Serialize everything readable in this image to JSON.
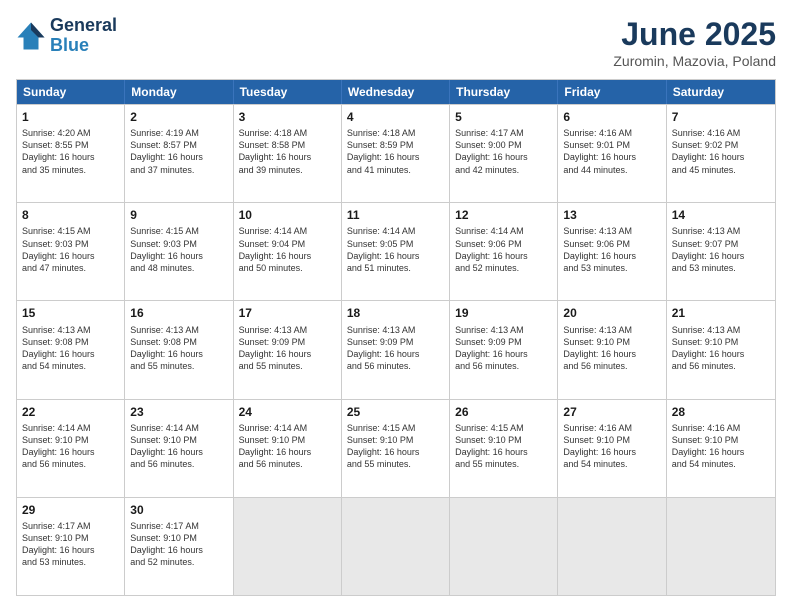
{
  "header": {
    "logo_line1": "General",
    "logo_line2": "Blue",
    "month": "June 2025",
    "location": "Zuromin, Mazovia, Poland"
  },
  "days_of_week": [
    "Sunday",
    "Monday",
    "Tuesday",
    "Wednesday",
    "Thursday",
    "Friday",
    "Saturday"
  ],
  "weeks": [
    [
      {
        "day": "1",
        "lines": [
          "Sunrise: 4:20 AM",
          "Sunset: 8:55 PM",
          "Daylight: 16 hours",
          "and 35 minutes."
        ]
      },
      {
        "day": "2",
        "lines": [
          "Sunrise: 4:19 AM",
          "Sunset: 8:57 PM",
          "Daylight: 16 hours",
          "and 37 minutes."
        ]
      },
      {
        "day": "3",
        "lines": [
          "Sunrise: 4:18 AM",
          "Sunset: 8:58 PM",
          "Daylight: 16 hours",
          "and 39 minutes."
        ]
      },
      {
        "day": "4",
        "lines": [
          "Sunrise: 4:18 AM",
          "Sunset: 8:59 PM",
          "Daylight: 16 hours",
          "and 41 minutes."
        ]
      },
      {
        "day": "5",
        "lines": [
          "Sunrise: 4:17 AM",
          "Sunset: 9:00 PM",
          "Daylight: 16 hours",
          "and 42 minutes."
        ]
      },
      {
        "day": "6",
        "lines": [
          "Sunrise: 4:16 AM",
          "Sunset: 9:01 PM",
          "Daylight: 16 hours",
          "and 44 minutes."
        ]
      },
      {
        "day": "7",
        "lines": [
          "Sunrise: 4:16 AM",
          "Sunset: 9:02 PM",
          "Daylight: 16 hours",
          "and 45 minutes."
        ]
      }
    ],
    [
      {
        "day": "8",
        "lines": [
          "Sunrise: 4:15 AM",
          "Sunset: 9:03 PM",
          "Daylight: 16 hours",
          "and 47 minutes."
        ]
      },
      {
        "day": "9",
        "lines": [
          "Sunrise: 4:15 AM",
          "Sunset: 9:03 PM",
          "Daylight: 16 hours",
          "and 48 minutes."
        ]
      },
      {
        "day": "10",
        "lines": [
          "Sunrise: 4:14 AM",
          "Sunset: 9:04 PM",
          "Daylight: 16 hours",
          "and 50 minutes."
        ]
      },
      {
        "day": "11",
        "lines": [
          "Sunrise: 4:14 AM",
          "Sunset: 9:05 PM",
          "Daylight: 16 hours",
          "and 51 minutes."
        ]
      },
      {
        "day": "12",
        "lines": [
          "Sunrise: 4:14 AM",
          "Sunset: 9:06 PM",
          "Daylight: 16 hours",
          "and 52 minutes."
        ]
      },
      {
        "day": "13",
        "lines": [
          "Sunrise: 4:13 AM",
          "Sunset: 9:06 PM",
          "Daylight: 16 hours",
          "and 53 minutes."
        ]
      },
      {
        "day": "14",
        "lines": [
          "Sunrise: 4:13 AM",
          "Sunset: 9:07 PM",
          "Daylight: 16 hours",
          "and 53 minutes."
        ]
      }
    ],
    [
      {
        "day": "15",
        "lines": [
          "Sunrise: 4:13 AM",
          "Sunset: 9:08 PM",
          "Daylight: 16 hours",
          "and 54 minutes."
        ]
      },
      {
        "day": "16",
        "lines": [
          "Sunrise: 4:13 AM",
          "Sunset: 9:08 PM",
          "Daylight: 16 hours",
          "and 55 minutes."
        ]
      },
      {
        "day": "17",
        "lines": [
          "Sunrise: 4:13 AM",
          "Sunset: 9:09 PM",
          "Daylight: 16 hours",
          "and 55 minutes."
        ]
      },
      {
        "day": "18",
        "lines": [
          "Sunrise: 4:13 AM",
          "Sunset: 9:09 PM",
          "Daylight: 16 hours",
          "and 56 minutes."
        ]
      },
      {
        "day": "19",
        "lines": [
          "Sunrise: 4:13 AM",
          "Sunset: 9:09 PM",
          "Daylight: 16 hours",
          "and 56 minutes."
        ]
      },
      {
        "day": "20",
        "lines": [
          "Sunrise: 4:13 AM",
          "Sunset: 9:10 PM",
          "Daylight: 16 hours",
          "and 56 minutes."
        ]
      },
      {
        "day": "21",
        "lines": [
          "Sunrise: 4:13 AM",
          "Sunset: 9:10 PM",
          "Daylight: 16 hours",
          "and 56 minutes."
        ]
      }
    ],
    [
      {
        "day": "22",
        "lines": [
          "Sunrise: 4:14 AM",
          "Sunset: 9:10 PM",
          "Daylight: 16 hours",
          "and 56 minutes."
        ]
      },
      {
        "day": "23",
        "lines": [
          "Sunrise: 4:14 AM",
          "Sunset: 9:10 PM",
          "Daylight: 16 hours",
          "and 56 minutes."
        ]
      },
      {
        "day": "24",
        "lines": [
          "Sunrise: 4:14 AM",
          "Sunset: 9:10 PM",
          "Daylight: 16 hours",
          "and 56 minutes."
        ]
      },
      {
        "day": "25",
        "lines": [
          "Sunrise: 4:15 AM",
          "Sunset: 9:10 PM",
          "Daylight: 16 hours",
          "and 55 minutes."
        ]
      },
      {
        "day": "26",
        "lines": [
          "Sunrise: 4:15 AM",
          "Sunset: 9:10 PM",
          "Daylight: 16 hours",
          "and 55 minutes."
        ]
      },
      {
        "day": "27",
        "lines": [
          "Sunrise: 4:16 AM",
          "Sunset: 9:10 PM",
          "Daylight: 16 hours",
          "and 54 minutes."
        ]
      },
      {
        "day": "28",
        "lines": [
          "Sunrise: 4:16 AM",
          "Sunset: 9:10 PM",
          "Daylight: 16 hours",
          "and 54 minutes."
        ]
      }
    ],
    [
      {
        "day": "29",
        "lines": [
          "Sunrise: 4:17 AM",
          "Sunset: 9:10 PM",
          "Daylight: 16 hours",
          "and 53 minutes."
        ]
      },
      {
        "day": "30",
        "lines": [
          "Sunrise: 4:17 AM",
          "Sunset: 9:10 PM",
          "Daylight: 16 hours",
          "and 52 minutes."
        ]
      },
      {
        "day": "",
        "lines": [],
        "empty": true
      },
      {
        "day": "",
        "lines": [],
        "empty": true
      },
      {
        "day": "",
        "lines": [],
        "empty": true
      },
      {
        "day": "",
        "lines": [],
        "empty": true
      },
      {
        "day": "",
        "lines": [],
        "empty": true
      }
    ]
  ]
}
